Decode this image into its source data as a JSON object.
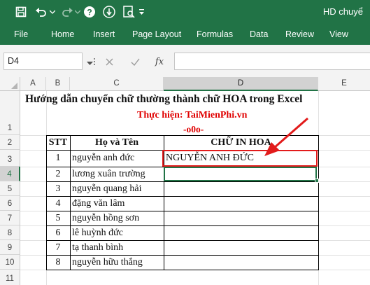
{
  "window": {
    "title": "HD chuyể"
  },
  "qat": {
    "icons": [
      "save-icon",
      "undo-icon",
      "redo-icon",
      "help-icon",
      "touch-mode-icon",
      "print-preview-icon",
      "customize-qat-icon"
    ]
  },
  "ribbon": {
    "tabs": [
      "File",
      "Home",
      "Insert",
      "Page Layout",
      "Formulas",
      "Data",
      "Review",
      "View"
    ]
  },
  "formula_bar": {
    "name_box": "D4",
    "fx_label": "fx",
    "content": ""
  },
  "columns": [
    "A",
    "B",
    "C",
    "D",
    "E"
  ],
  "rows": [
    "1",
    "2",
    "3",
    "4",
    "5",
    "6",
    "7",
    "8",
    "9",
    "10",
    "11"
  ],
  "sheet": {
    "title": "Hướng dẫn chuyển chữ thường thành chữ HOA trong Excel",
    "subtitle": "Thực hiện: TaiMienPhi.vn",
    "decoration": "-o0o-",
    "headers": {
      "stt": "STT",
      "name": "Họ và Tên",
      "upper": "CHỮ IN HOA"
    },
    "records": [
      {
        "stt": "1",
        "name": "nguyễn anh đức",
        "upper": "NGUYỄN ANH ĐỨC"
      },
      {
        "stt": "2",
        "name": "lương xuân trường",
        "upper": ""
      },
      {
        "stt": "3",
        "name": "nguyễn quang hải",
        "upper": ""
      },
      {
        "stt": "4",
        "name": "đặng văn lâm",
        "upper": ""
      },
      {
        "stt": "5",
        "name": "nguyễn hồng sơn",
        "upper": ""
      },
      {
        "stt": "6",
        "name": "lê huỳnh đức",
        "upper": ""
      },
      {
        "stt": "7",
        "name": "tạ thanh bình",
        "upper": ""
      },
      {
        "stt": "8",
        "name": "nguyễn hữu thắng",
        "upper": ""
      }
    ]
  },
  "colors": {
    "excel_green": "#217346",
    "highlight_red": "#e21b1b",
    "subtitle_red": "#e00000"
  }
}
